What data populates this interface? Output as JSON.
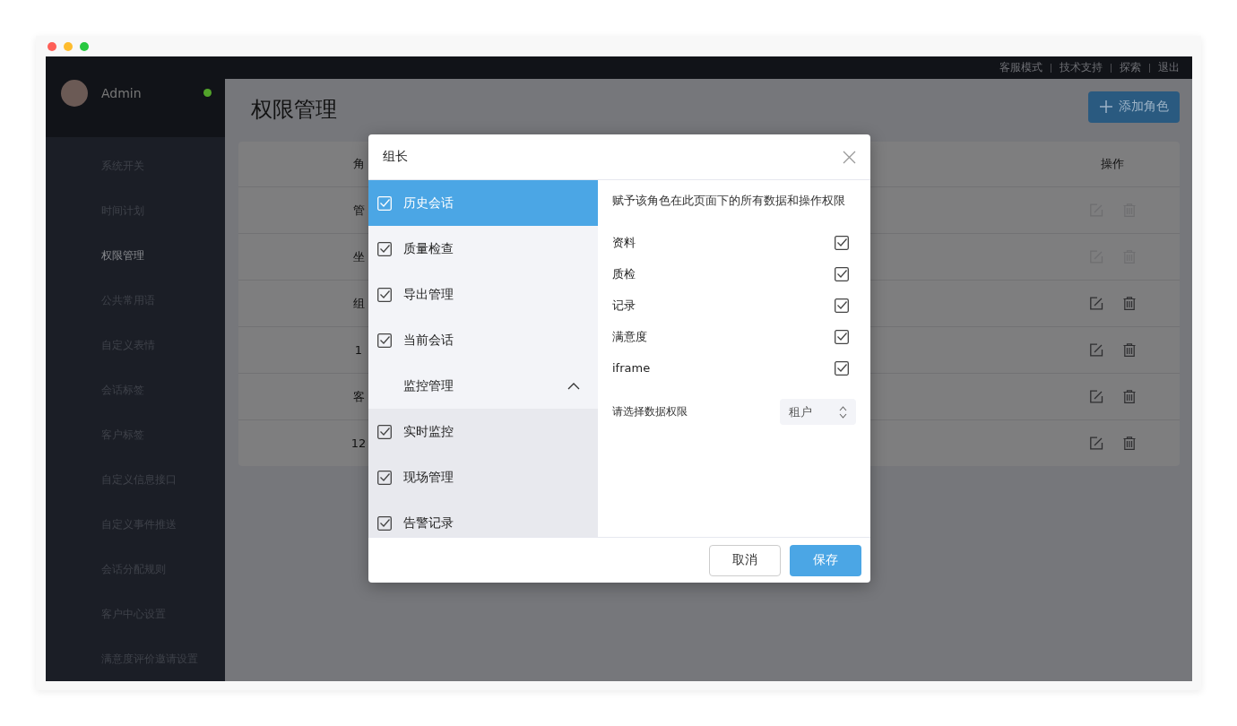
{
  "top_links": [
    "客服模式",
    "技术支持",
    "探索",
    "退出"
  ],
  "user": {
    "name": "Admin",
    "online": true
  },
  "sidebar": {
    "items": [
      {
        "label": "系统开关",
        "selected": false
      },
      {
        "label": "时间计划",
        "selected": false
      },
      {
        "label": "权限管理",
        "selected": true
      },
      {
        "label": "公共常用语",
        "selected": false
      },
      {
        "label": "自定义表情",
        "selected": false
      },
      {
        "label": "会话标签",
        "selected": false
      },
      {
        "label": "客户标签",
        "selected": false
      },
      {
        "label": "自定义信息接口",
        "selected": false
      },
      {
        "label": "自定义事件推送",
        "selected": false
      },
      {
        "label": "会话分配规则",
        "selected": false
      },
      {
        "label": "客户中心设置",
        "selected": false
      },
      {
        "label": "满意度评价邀请设置",
        "selected": false
      }
    ]
  },
  "page": {
    "title": "权限管理",
    "add_button": "添加角色"
  },
  "table": {
    "columns": [
      "角",
      "操作"
    ],
    "rows": [
      {
        "column_1": "管",
        "disabled": true
      },
      {
        "column_1": "坐",
        "disabled": true
      },
      {
        "column_1": "组",
        "disabled": false
      },
      {
        "column_1": "1",
        "disabled": false
      },
      {
        "column_1": "客",
        "disabled": false
      },
      {
        "column_1": "12",
        "disabled": false
      }
    ]
  },
  "dialog": {
    "title": "组长",
    "modules": [
      {
        "kind": "item",
        "label": "历史会话",
        "checked": true,
        "selected": true
      },
      {
        "kind": "item",
        "label": "质量检查",
        "checked": true,
        "selected": false
      },
      {
        "kind": "item",
        "label": "导出管理",
        "checked": true,
        "selected": false
      },
      {
        "kind": "item",
        "label": "当前会话",
        "checked": true,
        "selected": false
      },
      {
        "kind": "group",
        "label": "监控管理",
        "expanded": true,
        "children": [
          {
            "kind": "item",
            "label": "实时监控",
            "checked": true,
            "selected": false
          },
          {
            "kind": "item",
            "label": "现场管理",
            "checked": true,
            "selected": false
          },
          {
            "kind": "item",
            "label": "告警记录",
            "checked": true,
            "selected": false
          }
        ]
      }
    ],
    "description": "赋予该角色在此页面下的所有数据和操作权限",
    "permissions": [
      {
        "label": "资料",
        "checked": true
      },
      {
        "label": "质检",
        "checked": true
      },
      {
        "label": "记录",
        "checked": true
      },
      {
        "label": "满意度",
        "checked": true
      },
      {
        "label": "iframe",
        "checked": true
      }
    ],
    "data_scope": {
      "label": "请选择数据权限",
      "value": "租户"
    },
    "buttons": {
      "cancel": "取消",
      "save": "保存"
    }
  }
}
